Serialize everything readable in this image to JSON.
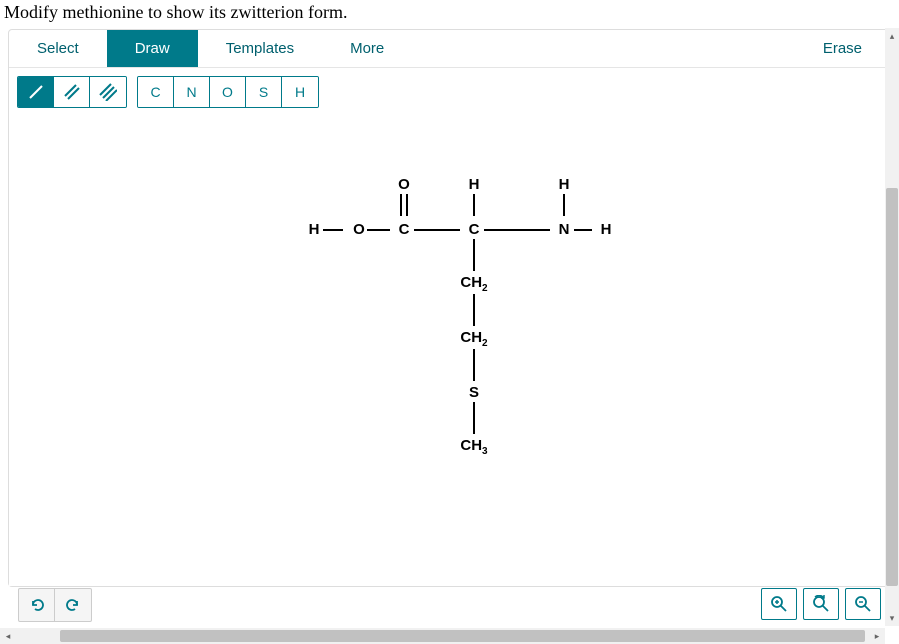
{
  "question": "Modify methionine to show its zwitterion form.",
  "tabs": {
    "select": "Select",
    "draw": "Draw",
    "templates": "Templates",
    "more": "More",
    "erase": "Erase"
  },
  "bond_tools": {
    "single": "/",
    "double": "//",
    "triple": "///"
  },
  "atom_tools": {
    "c": "C",
    "n": "N",
    "o": "O",
    "s": "S",
    "h": "H"
  },
  "molecule": {
    "atoms": {
      "h_left": "H",
      "o_left": "O",
      "c_carboxyl": "C",
      "o_top": "O",
      "c_alpha": "C",
      "h_alpha": "H",
      "n": "N",
      "h_ntop": "H",
      "h_nright": "H",
      "ch2_1": "CH",
      "ch2_1_sub": "2",
      "ch2_2": "CH",
      "ch2_2_sub": "2",
      "s": "S",
      "ch3": "CH",
      "ch3_sub": "3"
    }
  },
  "chart_data": {
    "type": "molecule",
    "name": "methionine",
    "atoms": [
      "H",
      "O",
      "C",
      "O",
      "C",
      "H",
      "N",
      "H",
      "H",
      "CH2",
      "CH2",
      "S",
      "CH3"
    ],
    "bonds": [
      {
        "from": "H",
        "to": "O",
        "type": "single"
      },
      {
        "from": "O",
        "to": "C",
        "type": "single"
      },
      {
        "from": "C",
        "to": "O",
        "type": "double"
      },
      {
        "from": "C",
        "to": "C_alpha",
        "type": "single"
      },
      {
        "from": "C_alpha",
        "to": "H",
        "type": "single"
      },
      {
        "from": "C_alpha",
        "to": "N",
        "type": "single"
      },
      {
        "from": "N",
        "to": "H",
        "type": "single"
      },
      {
        "from": "N",
        "to": "H",
        "type": "single"
      },
      {
        "from": "C_alpha",
        "to": "CH2",
        "type": "single"
      },
      {
        "from": "CH2",
        "to": "CH2",
        "type": "single"
      },
      {
        "from": "CH2",
        "to": "S",
        "type": "single"
      },
      {
        "from": "S",
        "to": "CH3",
        "type": "single"
      }
    ]
  }
}
